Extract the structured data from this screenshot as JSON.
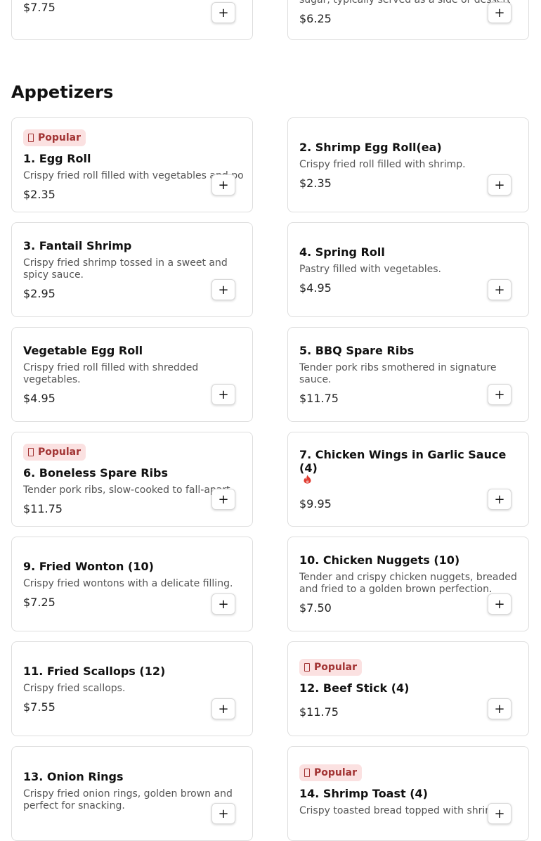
{
  "top_row": {
    "left": {
      "price": "$7.75"
    },
    "right": {
      "desc": "sugar, typically served as a side or dessert.",
      "price": "$6.25"
    }
  },
  "section": {
    "title": "Appetizers"
  },
  "badge_label": "Popular",
  "add_label": "+",
  "items": [
    {
      "name": "1. Egg Roll",
      "desc": "Crispy fried roll filled with vegetables and pork.",
      "price": "$2.35"
    },
    {
      "name": "2. Shrimp Egg Roll(ea)",
      "desc": "Crispy fried roll filled with shrimp.",
      "price": "$2.35"
    },
    {
      "name": "3. Fantail Shrimp",
      "desc": "Crispy fried shrimp tossed in a sweet and spicy sauce.",
      "price": "$2.95"
    },
    {
      "name": "4. Spring Roll",
      "desc": "Pastry filled with vegetables.",
      "price": "$4.95"
    },
    {
      "name": "Vegetable Egg Roll",
      "desc": "Crispy fried roll filled with shredded vegetables.",
      "price": "$4.95"
    },
    {
      "name": "5. BBQ Spare Ribs",
      "desc": "Tender pork ribs smothered in signature sauce.",
      "price": "$11.75"
    },
    {
      "name": "6. Boneless Spare Ribs",
      "desc": "Tender pork ribs, slow-cooked to fall-apart.",
      "price": "$11.75"
    },
    {
      "name": "7. Chicken Wings in Garlic Sauce (4)",
      "desc": "",
      "price": "$9.95"
    },
    {
      "name": "9. Fried Wonton (10)",
      "desc": "Crispy fried wontons with a delicate filling.",
      "price": "$7.25"
    },
    {
      "name": "10. Chicken Nuggets (10)",
      "desc": "Tender and crispy chicken nuggets, breaded and fried to a golden brown perfection.",
      "price": "$7.50"
    },
    {
      "name": "11. Fried Scallops (12)",
      "desc": "Crispy fried scallops.",
      "price": "$7.55"
    },
    {
      "name": "12. Beef Stick (4)",
      "desc": "",
      "price": "$11.75"
    },
    {
      "name": "13. Onion Rings",
      "desc": "Crispy fried onion rings, golden brown and perfect for snacking.",
      "price": ""
    },
    {
      "name": "14. Shrimp Toast (4)",
      "desc": "Crispy toasted bread topped with shrimp.",
      "price": ""
    }
  ],
  "icons": {
    "badge": "popular-icon",
    "spicy": "flame-icon",
    "add": "plus-icon"
  },
  "colors": {
    "badge_bg": "#fbe1e1",
    "badge_text": "#a23333",
    "flame": "#e03a2f"
  }
}
